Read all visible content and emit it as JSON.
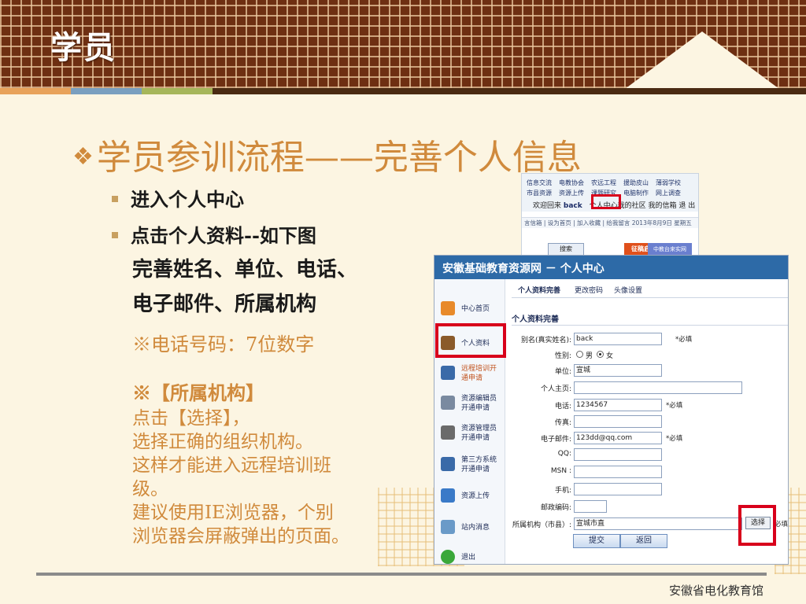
{
  "slide": {
    "header_title": "学员",
    "main_title_prefix": "❖",
    "main_title": "学员参训流程——完善个人信息",
    "bullets": [
      "进入个人中心",
      "点击个人资料--如下图"
    ],
    "sub_lines": [
      "完善姓名、单位、电话、",
      "电子邮件、所属机构"
    ],
    "phone_note": "※电话号码：7位数字",
    "org_note_title": "※【所属机构】",
    "org_note_lines": [
      "点击【选择】，",
      "选择正确的组织机构。",
      "这样才能进入远程培训班",
      "级。",
      "建议使用IE浏览器，个别",
      "浏览器会屏蔽弹出的页面。"
    ],
    "footer": "安徽省电化教育馆"
  },
  "shot1": {
    "nav_row1": [
      "信息交流",
      "电教协会",
      "农远工程",
      "援助皮山",
      "薄弱学校"
    ],
    "nav_row2": [
      "市县资源",
      "资源上传",
      "课题研究",
      "电脑制作",
      "网上调查"
    ],
    "welcome_prefix": "欢迎回来",
    "username": "back",
    "personal_center": "个人中心",
    "welcome_suffix": "我的社区 我的信箱 退 出",
    "bar_text": "言信箱 | 设为首页 | 加入收藏 | 给我留言    2013年8月9日 星期五",
    "search_button": "搜索",
    "badge1": "征稿启事",
    "badge2": "中教台来实网"
  },
  "shot2": {
    "window_title": "安徽基础教育资源网 － 个人中心",
    "sidebar": [
      {
        "label": "中心首页",
        "icon": "home-icon",
        "color": "#e88a2a"
      },
      {
        "label": "个人资料",
        "icon": "user-icon",
        "color": "#8a5a2a"
      },
      {
        "label": "远程培训开\n通申请",
        "icon": "star-icon",
        "color": "#3a6aa8"
      },
      {
        "label": "资源编辑员\n开通申请",
        "icon": "edit-icon",
        "color": "#7a8aa0"
      },
      {
        "label": "资源管理员\n开通申请",
        "icon": "bulb-icon",
        "color": "#6a6a6a"
      },
      {
        "label": "第三方系统\n开通申请",
        "icon": "star-icon",
        "color": "#3a6aa8"
      },
      {
        "label": "资源上传",
        "icon": "upload-icon",
        "color": "#3a7ac8"
      },
      {
        "label": "站内消息",
        "icon": "message-icon",
        "color": "#6a9ac8"
      },
      {
        "label": "退出",
        "icon": "exit-icon",
        "color": "#3aa83a"
      }
    ],
    "tabs": [
      "个人资料完善",
      "更改密码",
      "头像设置"
    ],
    "section_title": "个人资料完善",
    "fields": {
      "alias_label": "别名(真实姓名):",
      "alias_value": "back",
      "required": "*必填",
      "gender_label": "性别:",
      "gender_male": "男",
      "gender_female": "女",
      "unit_label": "单位:",
      "unit_value": "宣城",
      "homepage_label": "个人主页:",
      "phone_label": "电话:",
      "phone_value": "1234567",
      "fax_label": "传真:",
      "email_label": "电子邮件:",
      "email_value": "123dd@qq.com",
      "qq_label": "QQ:",
      "msn_label": "MSN :",
      "mobile_label": "手机:",
      "zip_label": "邮政编码:",
      "org_label": "所属机构（市县）:",
      "org_value": "宣城市直",
      "choose_button": "选择",
      "org_required": "必填"
    },
    "submit_button": "提交",
    "back_button": "返回"
  }
}
